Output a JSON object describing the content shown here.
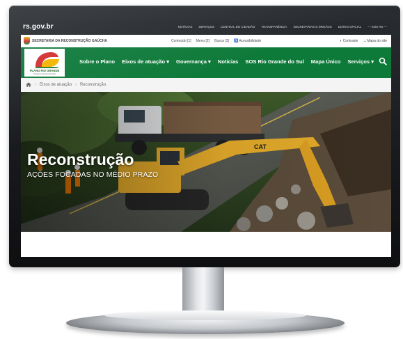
{
  "govbar": {
    "brand": "rs.gov.br",
    "links": [
      "NOTÍCIAS",
      "SERVIÇOS",
      "CENTRAL DO CIDADÃO",
      "TRANSPARÊNCIA",
      "SECRETARIAS E ÓRGÃOS",
      "DIÁRIO OFICIAL",
      "— SOS RS —"
    ]
  },
  "secbar": {
    "name": "SECRETARIA DA RECONSTRUÇÃO GAÚCHA",
    "tools": [
      "Conteúdo [1]",
      "Menu [2]",
      "Busca [3]",
      "♿ Acessibilidade"
    ],
    "contrast": "◐ Contraste",
    "sitemap": "⛬ Mapa do site"
  },
  "logo": {
    "text": "PLANO RIO GRANDE",
    "sub": "Programa de Reconstrução"
  },
  "nav": {
    "items": [
      "Sobre o Plano",
      "Eixos de atuação ▾",
      "Governança ▾",
      "Notícias",
      "SOS Rio Grande do Sul",
      "Mapa Único",
      "Serviços ▾"
    ],
    "search_icon": "search-icon"
  },
  "breadcrumb": {
    "home_icon": "home-icon",
    "items": [
      "Eixos de atuação",
      "Reconstrução"
    ]
  },
  "hero": {
    "title": "Reconstrução",
    "subtitle": "AÇÕES FOCADAS NO MÉDIO PRAZO"
  },
  "colors": {
    "nav_green": "#0e7a3a",
    "gov_bar": "#262a2e",
    "excavator_yellow": "#e0a82a"
  }
}
